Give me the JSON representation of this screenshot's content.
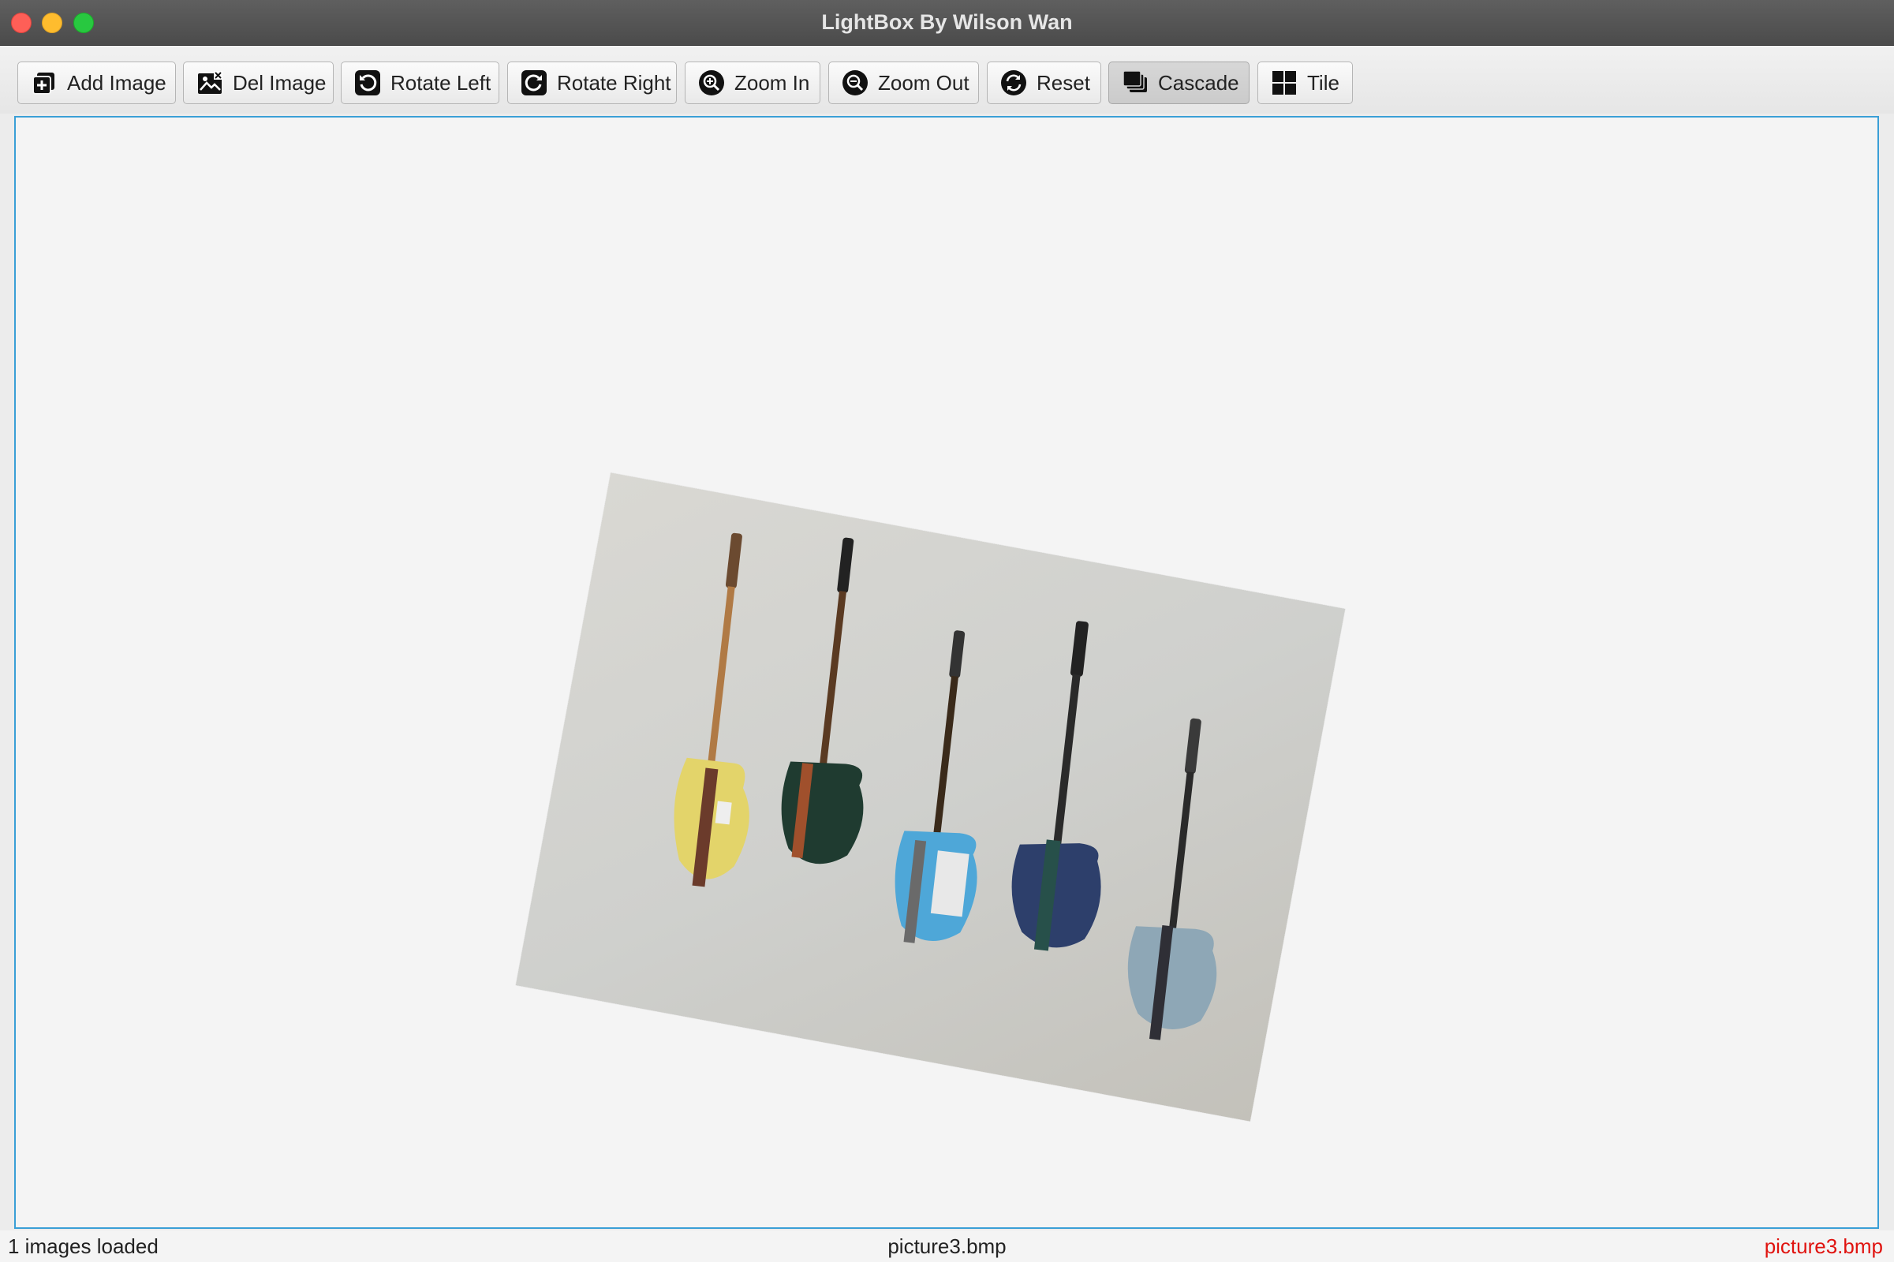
{
  "window": {
    "title": "LightBox By Wilson Wan"
  },
  "toolbar": {
    "buttons": [
      {
        "label": "Add Image",
        "icon": "add-image-icon"
      },
      {
        "label": "Del Image",
        "icon": "delete-image-icon"
      },
      {
        "label": "Rotate Left",
        "icon": "rotate-left-icon"
      },
      {
        "label": "Rotate Right",
        "icon": "rotate-right-icon"
      },
      {
        "label": "Zoom In",
        "icon": "zoom-in-icon"
      },
      {
        "label": "Zoom Out",
        "icon": "zoom-out-icon"
      },
      {
        "label": "Reset",
        "icon": "reset-icon"
      },
      {
        "label": "Cascade",
        "icon": "cascade-icon",
        "selected": true
      },
      {
        "label": "Tile",
        "icon": "tile-icon"
      }
    ]
  },
  "canvas": {
    "image": {
      "description_icon": "guitars-photo",
      "guitar_count": 5
    },
    "border_color": "#3a9fd6"
  },
  "status": {
    "left": "1 images loaded",
    "center": "picture3.bmp",
    "right": "picture3.bmp",
    "right_color": "#e0130f"
  }
}
